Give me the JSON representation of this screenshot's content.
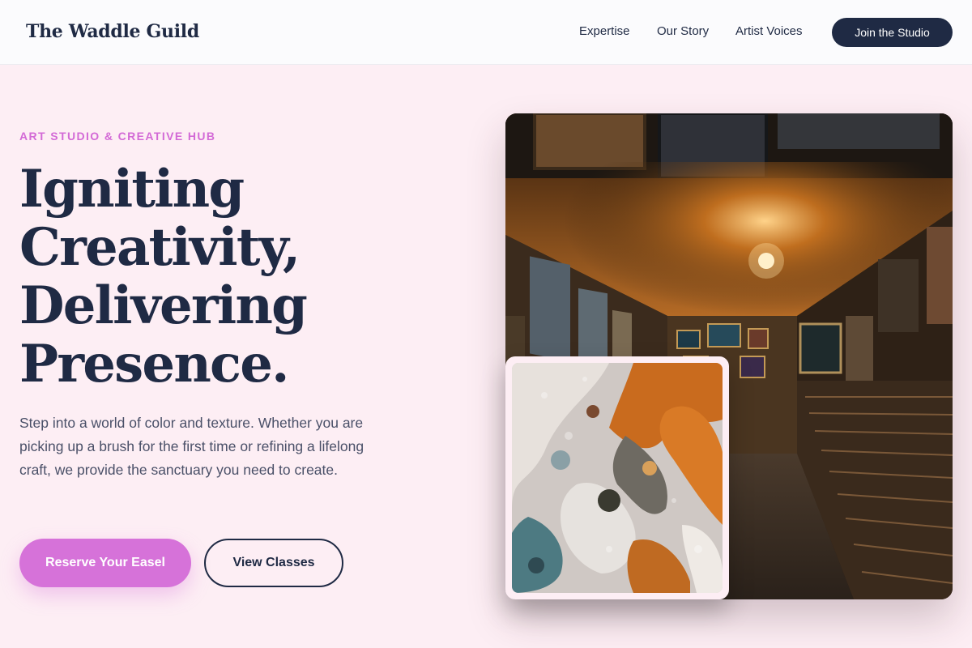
{
  "header": {
    "logo": "The Waddle Guild",
    "nav": [
      "Expertise",
      "Our Story",
      "Artist Voices"
    ],
    "cta": "Join the Studio"
  },
  "hero": {
    "eyebrow": "ART STUDIO & CREATIVE HUB",
    "headline": [
      "Igniting",
      "Creativity,",
      "Delivering",
      "Presence."
    ],
    "body": "Step into a world of color and texture. Whether you are picking up a brush for the first time or refining a lifelong craft, we provide the sanctuary you need to create.",
    "primary_cta": "Reserve Your Easel",
    "secondary_cta": "View Classes"
  },
  "images": {
    "gallery": "art-gallery-corridor-photo",
    "texture": "oil-paint-texture-photo"
  },
  "colors": {
    "background": "#fdeef4",
    "ink": "#1f2a44",
    "accent": "#d672d9",
    "eyebrow": "#d36ad6"
  }
}
